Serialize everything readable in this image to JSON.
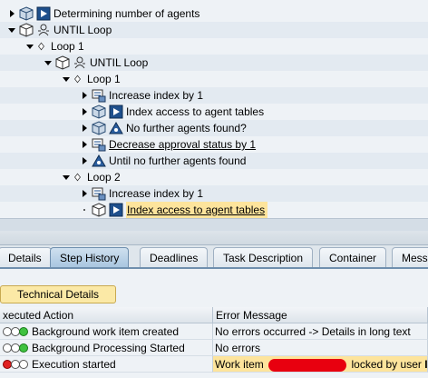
{
  "tree": {
    "rows": [
      {
        "label": "Determining number of agents"
      },
      {
        "label": "UNTIL Loop"
      },
      {
        "label": "Loop 1"
      },
      {
        "label": "UNTIL Loop"
      },
      {
        "label": "Loop 1"
      },
      {
        "label": "Increase index by 1"
      },
      {
        "label": "Index access to agent tables"
      },
      {
        "label": "No further agents found?"
      },
      {
        "label": "Decrease approval status by 1"
      },
      {
        "label": "Until no further agents found"
      },
      {
        "label": "Loop 2"
      },
      {
        "label": "Increase index by 1"
      },
      {
        "label": "Index access to agent tables"
      }
    ]
  },
  "tabs": [
    {
      "label": "Details"
    },
    {
      "label": "Step History"
    },
    {
      "label": "Deadlines"
    },
    {
      "label": "Task Description"
    },
    {
      "label": "Container"
    },
    {
      "label": "Mess"
    }
  ],
  "active_tab": "Step History",
  "technical_details_label": "Technical Details",
  "grid": {
    "col_action": "xecuted Action",
    "col_message": "Error Message",
    "rows": [
      {
        "action": "Background work item created",
        "message": "No errors occurred -> Details in long text",
        "lights": [
          "off",
          "off",
          "green"
        ]
      },
      {
        "action": "Background Processing Started",
        "message": "No errors",
        "lights": [
          "off",
          "off",
          "green"
        ]
      },
      {
        "action": "Execution started",
        "message_pre": "Work item",
        "message_post": "locked by user",
        "message_tail": "I",
        "lights": [
          "red",
          "off",
          "off"
        ]
      }
    ]
  },
  "colors": {
    "highlight": "#fde49c",
    "active_tab": "#a9c6e0",
    "redaction": "#e8000f"
  }
}
